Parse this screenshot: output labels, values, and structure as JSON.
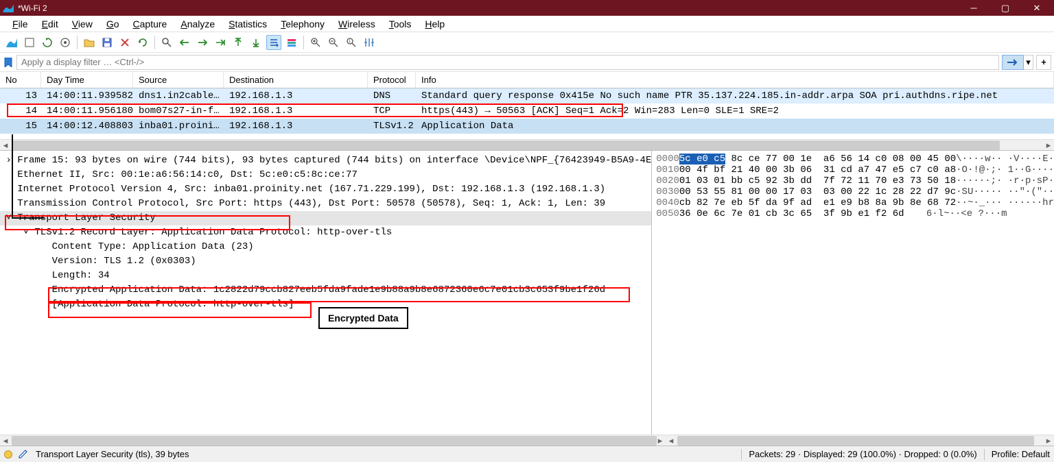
{
  "window": {
    "title": "*Wi-Fi 2"
  },
  "menu": [
    "File",
    "Edit",
    "View",
    "Go",
    "Capture",
    "Analyze",
    "Statistics",
    "Telephony",
    "Wireless",
    "Tools",
    "Help"
  ],
  "filter_placeholder": "Apply a display filter … <Ctrl-/>",
  "columns": [
    "No",
    "Day Time",
    "Source",
    "Destination",
    "Protocol",
    "Info"
  ],
  "packets": [
    {
      "no": 13,
      "time": "14:00:11.939582",
      "src": "dns1.in2cable…",
      "dst": "192.168.1.3",
      "proto": "DNS",
      "info": "Standard query response 0x415e No such name PTR 35.137.224.185.in-addr.arpa SOA pri.authdns.ripe.net",
      "cls": "dns"
    },
    {
      "no": 14,
      "time": "14:00:11.956180",
      "src": "bom07s27-in-f…",
      "dst": "192.168.1.3",
      "proto": "TCP",
      "info": "https(443) → 50563 [ACK] Seq=1 Ack=2 Win=283 Len=0 SLE=1 SRE=2",
      "cls": ""
    },
    {
      "no": 15,
      "time": "14:00:12.408803",
      "src": "inba01.proini…",
      "dst": "192.168.1.3",
      "proto": "TLSv1.2",
      "info": "Application Data",
      "cls": "tls sel"
    }
  ],
  "tree": [
    {
      "indent": 0,
      "exp": ">",
      "text": "Frame 15: 93 bytes on wire (744 bits), 93 bytes captured (744 bits) on interface \\Device\\NPF_{76423949-B5A9-4E"
    },
    {
      "indent": 0,
      "exp": " ",
      "text": "Ethernet II, Src: 00:1e:a6:56:14:c0, Dst: 5c:e0:c5:8c:ce:77"
    },
    {
      "indent": 0,
      "exp": " ",
      "text": "Internet Protocol Version 4, Src: inba01.proinity.net (167.71.229.199), Dst: 192.168.1.3 (192.168.1.3)"
    },
    {
      "indent": 0,
      "exp": " ",
      "text": "Transmission Control Protocol, Src Port: https (443), Dst Port: 50578 (50578), Seq: 1, Ack: 1, Len: 39"
    },
    {
      "indent": 0,
      "exp": "v",
      "text": "Transport Layer Security",
      "sel": true
    },
    {
      "indent": 1,
      "exp": "v",
      "text": "TLSv1.2 Record Layer: Application Data Protocol: http-over-tls"
    },
    {
      "indent": 2,
      "exp": " ",
      "text": "Content Type: Application Data (23)"
    },
    {
      "indent": 2,
      "exp": " ",
      "text": "Version: TLS 1.2 (0x0303)"
    },
    {
      "indent": 2,
      "exp": " ",
      "text": "Length: 34"
    },
    {
      "indent": 2,
      "exp": " ",
      "text": "Encrypted Application Data: 1c2822d79ccb827eeb5fda9fade1e9b88a9b8e6872360e6c7e01cb3c653f9be1f26d"
    },
    {
      "indent": 2,
      "exp": " ",
      "text": "[Application Data Protocol: http-over-tls]"
    }
  ],
  "hex": [
    {
      "off": "0000",
      "b": "5c e0 c5 8c ce 77 00 1e  a6 56 14 c0 08 00 45 00",
      "a": "\\····w·· ·V····E·",
      "hl": [
        0,
        8
      ]
    },
    {
      "off": "0010",
      "b": "00 4f bf 21 40 00 3b 06  31 cd a7 47 e5 c7 c0 a8",
      "a": "·O·!@·;· 1··G····"
    },
    {
      "off": "0020",
      "b": "01 03 01 bb c5 92 3b dd  7f 72 11 70 e3 73 50 18",
      "a": "······;· ·r·p·sP·"
    },
    {
      "off": "0030",
      "b": "00 53 55 81 00 00 17 03  03 00 22 1c 28 22 d7 9c",
      "a": "·SU····· ··\"·(\"··"
    },
    {
      "off": "0040",
      "b": "cb 82 7e eb 5f da 9f ad  e1 e9 b8 8a 9b 8e 68 72",
      "a": "··~·_··· ······hr"
    },
    {
      "off": "0050",
      "b": "36 0e 6c 7e 01 cb 3c 65  3f 9b e1 f2 6d",
      "a": "6·l~··<e ?···m"
    }
  ],
  "annotation": "Encrypted Data",
  "status": {
    "left": "Transport Layer Security (tls), 39 bytes",
    "packets": "Packets: 29 · Displayed: 29 (100.0%) · Dropped: 0 (0.0%)",
    "profile": "Profile: Default"
  }
}
